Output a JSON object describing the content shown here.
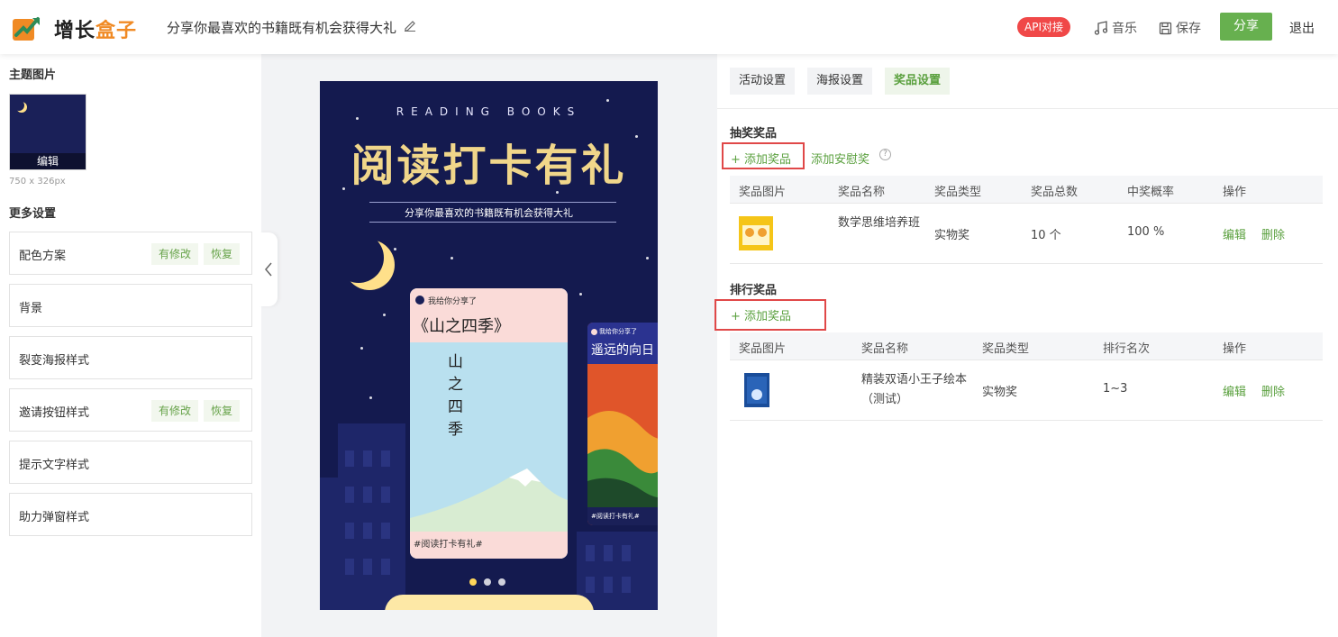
{
  "header": {
    "logo_part1": "增长",
    "logo_part2": "盒子",
    "title": "分享你最喜欢的书籍既有机会获得大礼",
    "api_badge": "API对接",
    "music_label": "音乐",
    "save_label": "保存",
    "share_label": "分享",
    "exit_label": "退出"
  },
  "left": {
    "theme_title": "主题图片",
    "edit_label": "编辑",
    "theme_size": "750 x 326px",
    "more_title": "更多设置",
    "modified_label": "有修改",
    "restore_label": "恢复",
    "rows": [
      {
        "label": "配色方案",
        "modified": true
      },
      {
        "label": "背景",
        "modified": false
      },
      {
        "label": "裂变海报样式",
        "modified": false
      },
      {
        "label": "邀请按钮样式",
        "modified": true
      },
      {
        "label": "提示文字样式",
        "modified": false
      },
      {
        "label": "助力弹窗样式",
        "modified": false
      }
    ]
  },
  "poster": {
    "subtitle": "READING BOOKS",
    "main_title": "阅读打卡有礼",
    "description": "分享你最喜欢的书籍既有机会获得大礼",
    "card1": {
      "share_text": "我给你分享了",
      "book_name": "《山之四季》",
      "vertical_title": "山之四季",
      "footer": "#阅读打卡有礼#"
    },
    "card2": {
      "share_text": "我给你分享了",
      "book_name": "遥远的向日",
      "footer": "#阅读打卡有礼#"
    }
  },
  "right": {
    "tabs": [
      "活动设置",
      "海报设置",
      "奖品设置"
    ],
    "active_tab": "奖品设置",
    "lottery": {
      "title": "抽奖奖品",
      "add_label": "+ 添加奖品",
      "add_consolation": "添加安慰奖",
      "headers": [
        "奖品图片",
        "奖品名称",
        "奖品类型",
        "奖品总数",
        "中奖概率",
        "操作"
      ],
      "rows": [
        {
          "name": "数学思维培养班",
          "type": "实物奖",
          "total": "10 个",
          "probability": "100 %",
          "edit": "编辑",
          "delete": "删除"
        }
      ]
    },
    "ranking": {
      "title": "排行奖品",
      "add_label": "+ 添加奖品",
      "headers": [
        "奖品图片",
        "奖品名称",
        "奖品类型",
        "排行名次",
        "操作"
      ],
      "rows": [
        {
          "name": "精装双语小王子绘本（测试）",
          "type": "实物奖",
          "rank": "1~3",
          "edit": "编辑",
          "delete": "删除"
        }
      ]
    }
  },
  "colors": {
    "accent_green": "#67b04f",
    "api_red": "#f04848",
    "highlight_red": "#e04848",
    "poster_bg": "#141a4f",
    "title_gold": "#f0d68a"
  }
}
